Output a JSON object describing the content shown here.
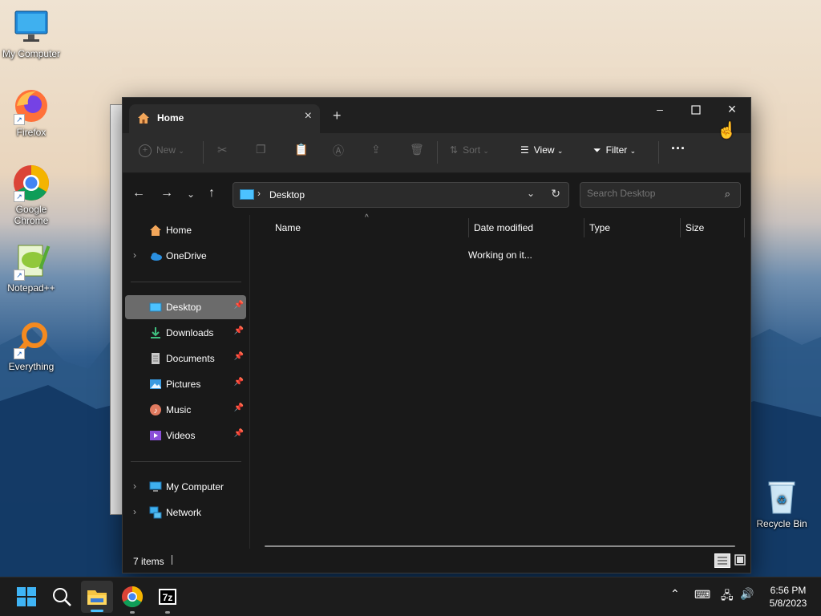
{
  "desktop": {
    "icons": [
      {
        "label": "My Computer"
      },
      {
        "label": "Firefox"
      },
      {
        "label": "Google Chrome"
      },
      {
        "label": "Notepad++"
      },
      {
        "label": "Everything"
      },
      {
        "label": "Recycle Bin"
      }
    ]
  },
  "explorer": {
    "tab_title": "Home",
    "toolbar": {
      "new_label": "New",
      "sort_label": "Sort",
      "view_label": "View",
      "filter_label": "Filter"
    },
    "address": {
      "crumb": "Desktop"
    },
    "search": {
      "placeholder": "Search Desktop"
    },
    "sidebar": {
      "items": [
        {
          "label": "Home"
        },
        {
          "label": "OneDrive"
        },
        {
          "label": "Desktop"
        },
        {
          "label": "Downloads"
        },
        {
          "label": "Documents"
        },
        {
          "label": "Pictures"
        },
        {
          "label": "Music"
        },
        {
          "label": "Videos"
        },
        {
          "label": "My Computer"
        },
        {
          "label": "Network"
        }
      ]
    },
    "columns": {
      "name": "Name",
      "date": "Date modified",
      "type": "Type",
      "size": "Size"
    },
    "loading_text": "Working on it...",
    "status": {
      "count": "7 items"
    }
  },
  "taskbar": {
    "time": "6:56 PM",
    "date": "5/8/2023"
  },
  "colors": {
    "accent": "#4cc2ff",
    "window_bg": "#191919",
    "toolbar_bg": "#2c2c2c",
    "selected": "#6b6b6b"
  }
}
